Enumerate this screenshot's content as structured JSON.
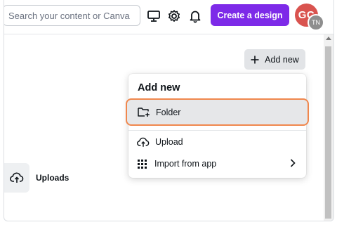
{
  "topbar": {
    "search_placeholder": "Search your content or Canva",
    "create_button": "Create a design",
    "avatar_initials": "GC",
    "avatar_sub_initials": "TN"
  },
  "main": {
    "add_new_button": "Add new",
    "uploads_label": "Uploads"
  },
  "menu": {
    "title": "Add new",
    "items": [
      {
        "label": "Folder",
        "icon": "folder-plus-icon"
      },
      {
        "label": "Upload",
        "icon": "cloud-upload-icon"
      },
      {
        "label": "Import from app",
        "icon": "grid-icon"
      }
    ]
  },
  "colors": {
    "accent": "#7d2ae8",
    "highlight_border": "#f0874d",
    "avatar": "#d9534f"
  }
}
